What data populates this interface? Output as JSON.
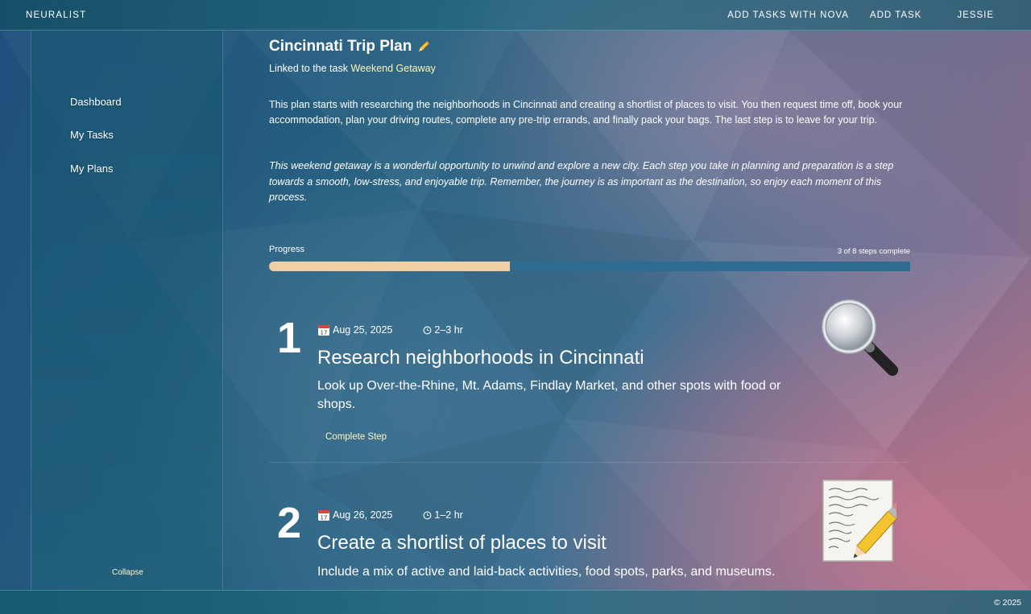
{
  "header": {
    "brand": "NEURALIST",
    "nav": {
      "add_with_nova": "ADD TASKS WITH NOVA",
      "add_task": "ADD TASK",
      "user": "JESSIE"
    }
  },
  "sidebar": {
    "items": [
      {
        "label": "Dashboard"
      },
      {
        "label": "My Tasks"
      },
      {
        "label": "My Plans"
      }
    ],
    "collapse_label": "Collapse"
  },
  "plan": {
    "title": "Cincinnati Trip Plan",
    "linked_prefix": "Linked to the task",
    "linked_task": "Weekend Getaway",
    "description": "This plan starts with researching the neighborhoods in Cincinnati and creating a shortlist of places to visit. You then request time off, book your accommodation, plan your driving routes, complete any pre-trip errands, and finally pack your bags. The last step is to leave for your trip.",
    "quote": "This weekend getaway is a wonderful opportunity to unwind and explore a new city. Each step you take in planning and preparation is a step towards a smooth, low-stress, and enjoyable trip. Remember, the journey is as important as the destination, so enjoy each moment of this process.",
    "progress": {
      "label": "Progress",
      "summary": "3 of 8 steps complete",
      "completed": 3,
      "total": 8,
      "fill_color": "#f0cfa6",
      "track_color": "#2d6c90"
    },
    "steps": [
      {
        "number": "1",
        "date": "Aug 25, 2025",
        "duration": "2–3 hr",
        "title": "Research neighborhoods in Cincinnati",
        "description": "Look up Over-the-Rhine, Mt. Adams, Findlay Market, and other spots with food or shops.",
        "action": "Complete Step",
        "icon": "magnifying-glass-icon"
      },
      {
        "number": "2",
        "date": "Aug 26, 2025",
        "duration": "1–2 hr",
        "title": "Create a shortlist of places to visit",
        "description": "Include a mix of active and laid-back activities, food spots, parks, and museums.",
        "icon": "notepad-pencil-icon"
      }
    ]
  },
  "footer": {
    "copyright": "© 2025"
  }
}
